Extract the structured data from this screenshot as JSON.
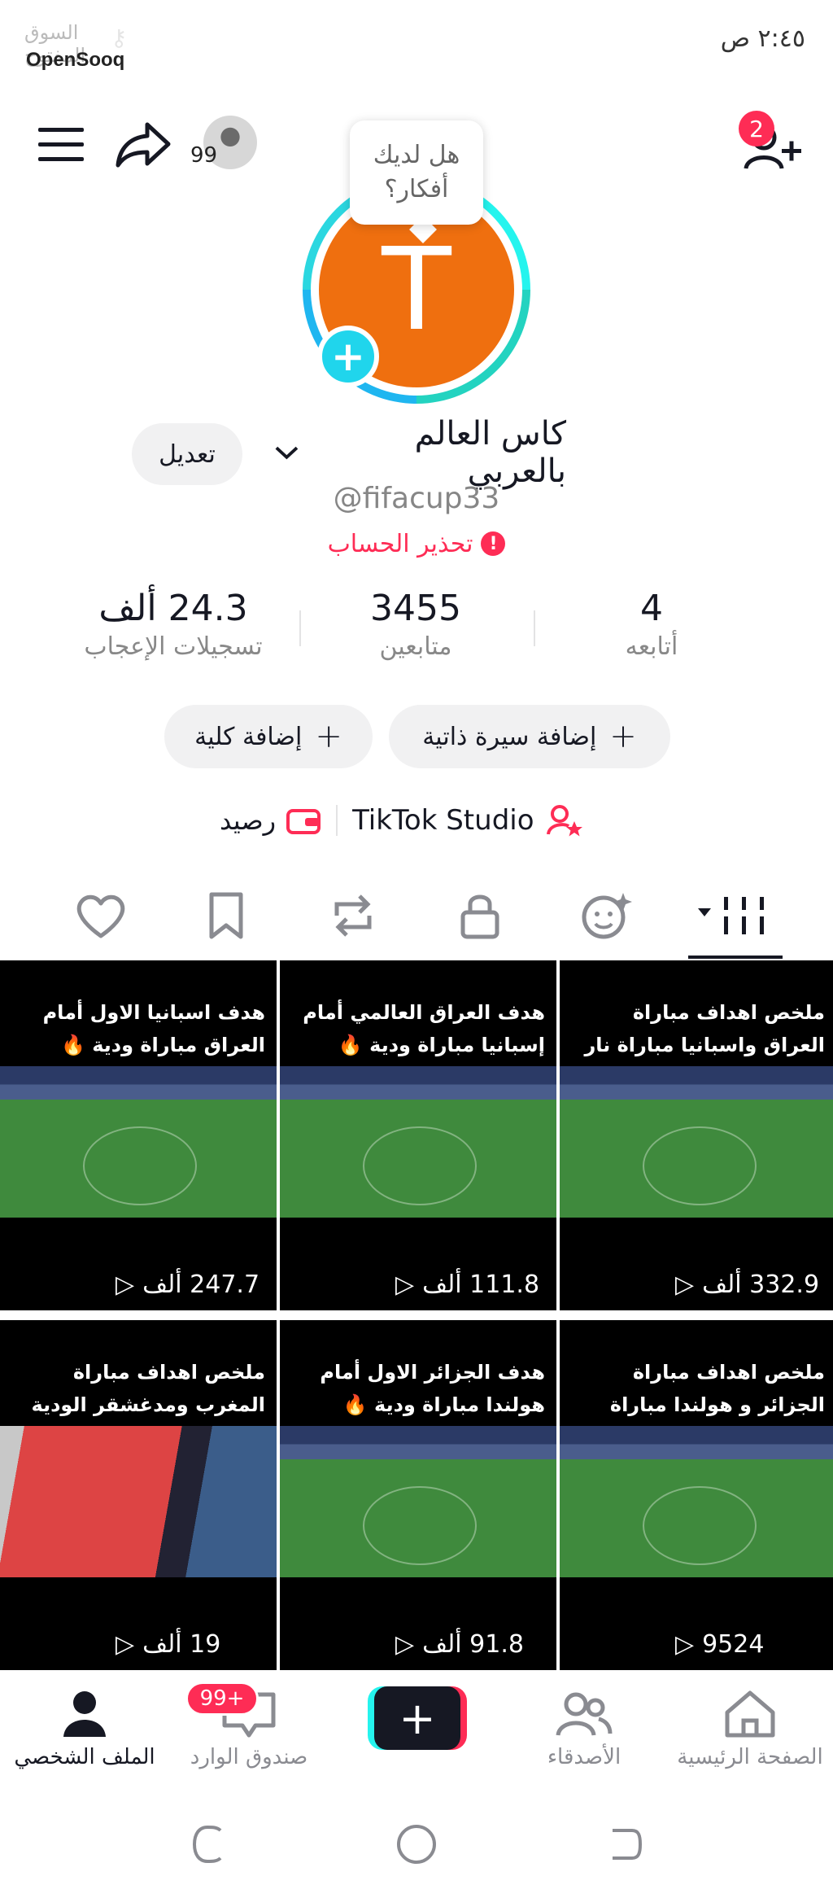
{
  "status_bar": {
    "time": "٢:٤٥ ص"
  },
  "watermark": {
    "top_text": "السوق المفتوح",
    "brand": "OpenSooq"
  },
  "header": {
    "visitor_count": "99",
    "notification_count": "2"
  },
  "avatar": {
    "letter": "T",
    "bubble_text": "هل لديك أفكار؟"
  },
  "profile": {
    "name": "كاس العالم بالعربي",
    "handle": "@fifacup33",
    "warning": "تحذير الحساب",
    "edit_label": "تعديل"
  },
  "stats": [
    {
      "value": "4",
      "label": "أتابعه"
    },
    {
      "value": "3455",
      "label": "متابعين"
    },
    {
      "value": "24.3 ألف",
      "label": "تسجيلات الإعجاب"
    }
  ],
  "actions": {
    "add_bio": "إضافة سيرة ذاتية",
    "add_college": "إضافة كلية"
  },
  "studio_row": {
    "studio": "TikTok Studio",
    "balance": "رصيد"
  },
  "videos": [
    {
      "title": "ملخص اهداف مباراة العراق واسبانيا مباراة نار 🔥",
      "views": "332.9 ألف",
      "thumb": "field"
    },
    {
      "title": "هدف العراق العالمي أمام إسبانيا مباراة ودية 🔥",
      "views": "111.8 ألف",
      "thumb": "field"
    },
    {
      "title": "هدف اسبانيا الاول أمام العراق مباراة ودية 🔥",
      "views": "247.7 ألف",
      "thumb": "field"
    },
    {
      "title": "ملخص اهداف مباراة الجزائر و هولندا مباراة ودية 🔥",
      "views": "9524",
      "thumb": "field"
    },
    {
      "title": "هدف الجزائر الاول أمام هولندا مباراة ودية 🔥",
      "views": "91.8 ألف",
      "thumb": "field"
    },
    {
      "title": "ملخص اهداف مباراة المغرب ومدغشقر الودية",
      "views": "19 ألف",
      "thumb": "portrait"
    }
  ],
  "bottom_nav": {
    "home": "الصفحة الرئيسية",
    "friends": "الأصدقاء",
    "inbox": "صندوق الوارد",
    "inbox_badge": "99+",
    "profile": "الملف الشخصي"
  },
  "colors": {
    "accent_red": "#fe2c55",
    "accent_cyan": "#25f4ee",
    "avatar_orange": "#ef6f0f"
  }
}
